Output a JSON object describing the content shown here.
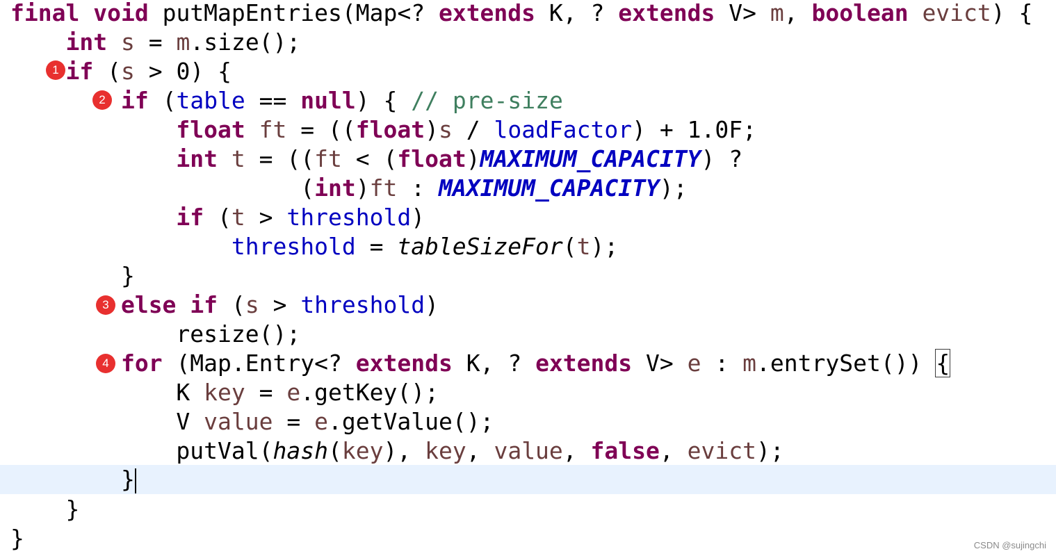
{
  "code": {
    "t_final": "final",
    "t_void": "void",
    "t_method": "putMapEntries(Map<?",
    "t_extends": "extends",
    "t_K": "K,",
    "t_q": "?",
    "t_V": "V>",
    "t_m": "m",
    "t_comma": ",",
    "t_boolean": "boolean",
    "t_evict": "evict",
    "t_open_brace": ") {",
    "t_int": "int",
    "t_s": "s",
    "t_eq": "=",
    "t_size": ".size();",
    "t_if": "if",
    "t_paren_open": "(",
    "t_gt0": "> 0) {",
    "t_table": "table",
    "t_eqnull": "==",
    "t_null": "null",
    "t_close_brace_open": ") {",
    "t_comment": "// pre-size",
    "t_float": "float",
    "t_ft": "ft",
    "t_eq_open2": "= ((",
    "t_close_paren": ")",
    "t_div": "/",
    "t_loadFactor": "loadFactor",
    "t_plus": ") + 1.0F;",
    "t_t": "t",
    "t_lt": "<",
    "t_max": "MAXIMUM_CAPACITY",
    "t_ternary": ") ?",
    "t_colon": ":",
    "t_end": ");",
    "t_threshold": "threshold",
    "t_gt": ">",
    "t_tableSizeFor": "tableSizeFor",
    "t_close_brace": "}",
    "t_else": "else",
    "t_resize": "resize();",
    "t_for": "for",
    "t_entry": "(Map.Entry<?",
    "t_e": "e",
    "t_entrySet": ".entrySet())",
    "t_brace": "{",
    "t_Kplain": "K",
    "t_key": "key",
    "t_getKey": ".getKey();",
    "t_Vplain": "V",
    "t_value": "value",
    "t_getValue": ".getValue();",
    "t_putVal": "putVal(",
    "t_hash": "hash",
    "t_false": "false"
  },
  "badges": {
    "b1": "1",
    "b2": "2",
    "b3": "3",
    "b4": "4"
  },
  "watermark": "CSDN @sujingchi",
  "colors": {
    "keyword": "#7f0055",
    "local_variable": "#6a3e3e",
    "field": "#0000c0",
    "comment": "#3f7f5f",
    "current_line": "#e8f2fe",
    "badge": "#e8302f"
  }
}
